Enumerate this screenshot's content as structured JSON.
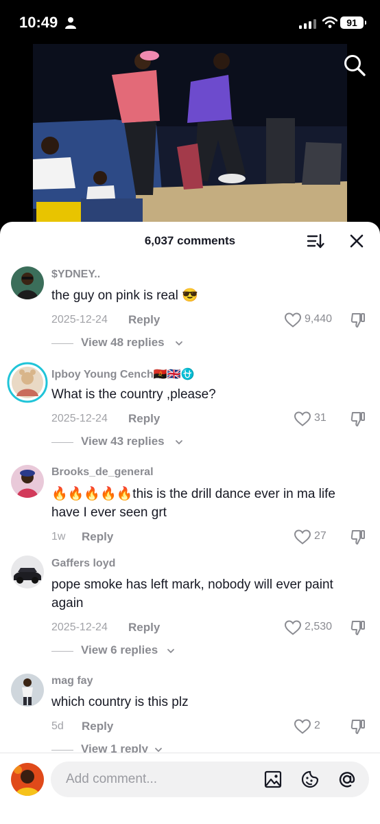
{
  "status_bar": {
    "time": "10:49",
    "battery": "91"
  },
  "comments_sheet": {
    "title": "6,037 comments"
  },
  "comments": [
    {
      "username": "$YDNEY..",
      "text": "the guy on pink is real 😎",
      "date": "2025-12-24",
      "reply_label": "Reply",
      "likes": "9,440",
      "view_replies": "View 48 replies"
    },
    {
      "username": "Ipboy Young Cench🇦🇴🇬🇧⛎",
      "text": "What is the country ,please?",
      "date": "2025-12-24",
      "reply_label": "Reply",
      "likes": "31",
      "view_replies": "View 43 replies"
    },
    {
      "username": "Brooks_de_general",
      "text": "🔥🔥🔥🔥🔥this is the drill dance ever in ma life have I ever seen grt",
      "date": "1w",
      "reply_label": "Reply",
      "likes": "27"
    },
    {
      "username": "Gaffers loyd",
      "text": "pope smoke has left mark, nobody will ever paint again",
      "date": "2025-12-24",
      "reply_label": "Reply",
      "likes": "2,530",
      "view_replies": "View 6 replies"
    },
    {
      "username": "mag fay",
      "text": "which country is this plz",
      "date": "5d",
      "reply_label": "Reply",
      "likes": "2",
      "view_replies": "View 1 reply"
    }
  ],
  "composer": {
    "placeholder": "Add comment..."
  },
  "icons": [
    "person-icon",
    "signal-icon",
    "wifi-icon",
    "search-icon",
    "sort-icon",
    "close-icon",
    "heart-icon",
    "dislike-icon",
    "chevron-down-icon",
    "image-icon",
    "emoji-icon",
    "mention-icon"
  ],
  "colors": {
    "sheet_bg": "#ffffff",
    "text_primary": "#161823",
    "text_secondary": "#8a8b91",
    "accent_ring": "#20c4d8"
  }
}
